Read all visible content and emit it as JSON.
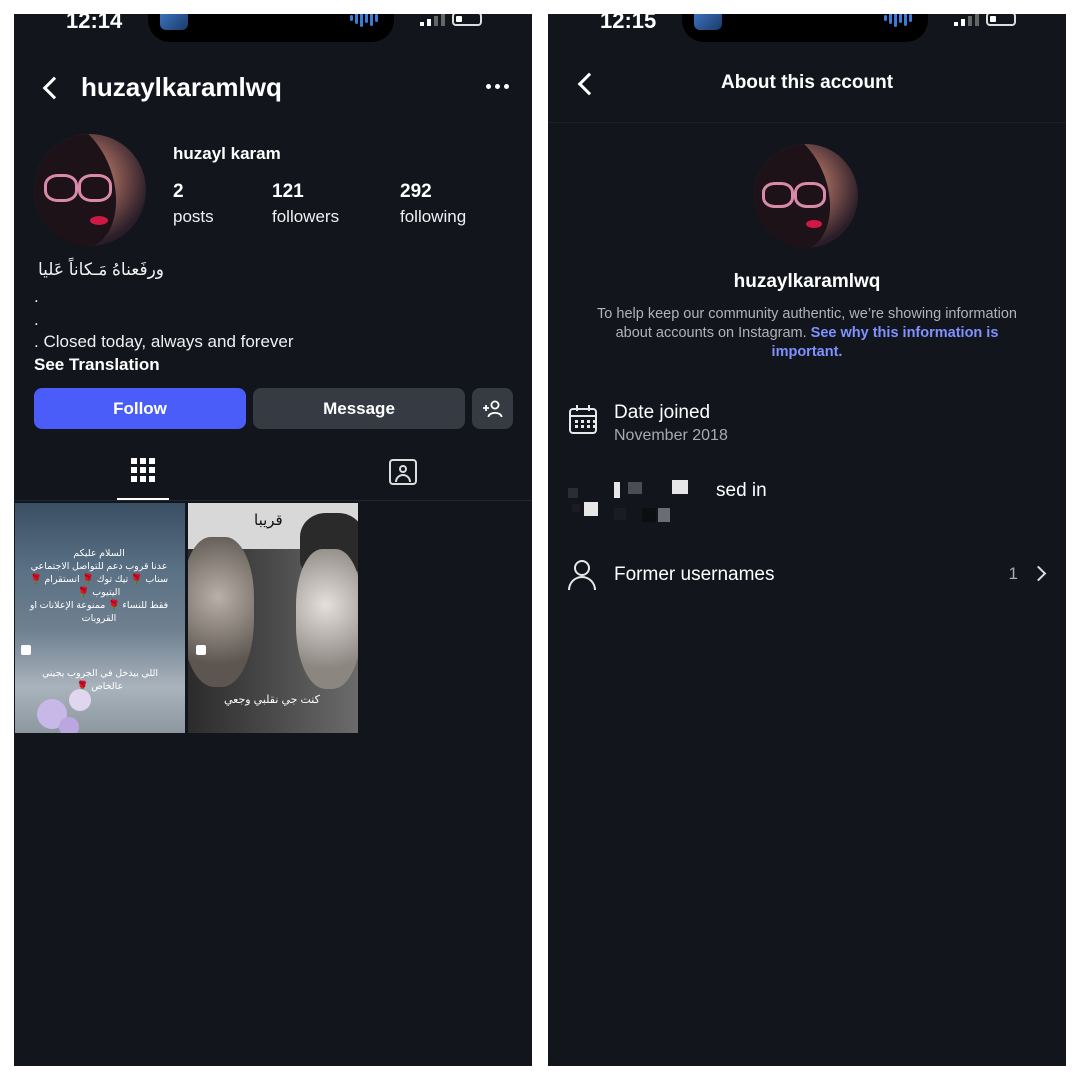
{
  "left": {
    "status_time": "12:14",
    "header": {
      "username": "huzaylkaramlwq"
    },
    "profile": {
      "display_name": "huzayl karam",
      "stats": {
        "posts": {
          "value": "2",
          "label": "posts"
        },
        "followers": {
          "value": "121",
          "label": "followers"
        },
        "following": {
          "value": "292",
          "label": "following"
        }
      },
      "bio": [
        "ورفَعناهُ مَـكاناً عَليا",
        ".",
        ".",
        ". Closed today, always and forever"
      ],
      "see_translation": "See Translation"
    },
    "actions": {
      "follow_label": "Follow",
      "message_label": "Message"
    },
    "posts": [
      {
        "text_lines": [
          "السلام عليكم",
          "عدنا قروب دعم للتواصل الاجتماعي",
          "سناب 🌹 تيك توك 🌹 انستقرام 🌹",
          "اليتيوب 🌹",
          "فقط للنساء 🌹 ممنوعة الإعلانات او",
          "القروبات"
        ],
        "footer_lines": [
          "اللي بيدخل في الجروب يجيني",
          "عالخاص 🌹"
        ]
      },
      {
        "title": "قريبا",
        "caption": "كنت جي نقلبي وجعي"
      }
    ]
  },
  "right": {
    "status_time": "12:15",
    "header": {
      "title": "About this account"
    },
    "username": "huzaylkaramlwq",
    "description": "To help keep our community authentic, we’re showing information about accounts on Instagram.",
    "description_link": "See why this information is important.",
    "rows": {
      "date_joined": {
        "title": "Date joined",
        "value": "November 2018"
      },
      "account_based_in": {
        "title": "sed in"
      },
      "former_usernames": {
        "title": "Former usernames",
        "count": "1"
      }
    }
  }
}
